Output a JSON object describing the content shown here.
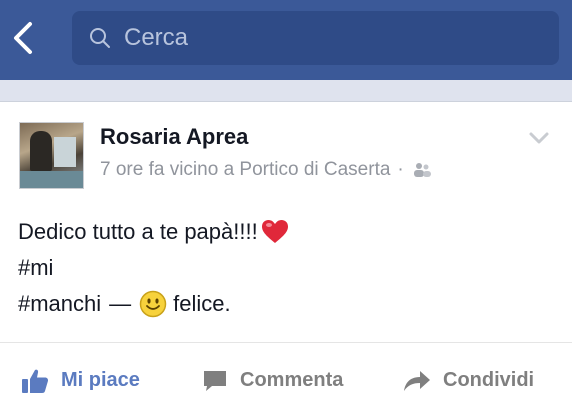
{
  "header": {
    "search_placeholder": "Cerca"
  },
  "post": {
    "author": "Rosaria Aprea",
    "timestamp": "7 ore fa vicino a Portico di Caserta",
    "separator": "·",
    "privacy_icon": "friends-icon",
    "text_line1": "Dedico tutto a te papà!!!!",
    "hashtag1": "#mi",
    "hashtag2": "#manchi",
    "dash": "—",
    "feeling": "felice."
  },
  "actions": {
    "like_label": "Mi piace",
    "comment_label": "Commenta",
    "share_label": "Condividi"
  },
  "colors": {
    "brand_blue": "#3b5998",
    "like_blue": "#5b7bc0",
    "muted_text": "#90949c"
  }
}
